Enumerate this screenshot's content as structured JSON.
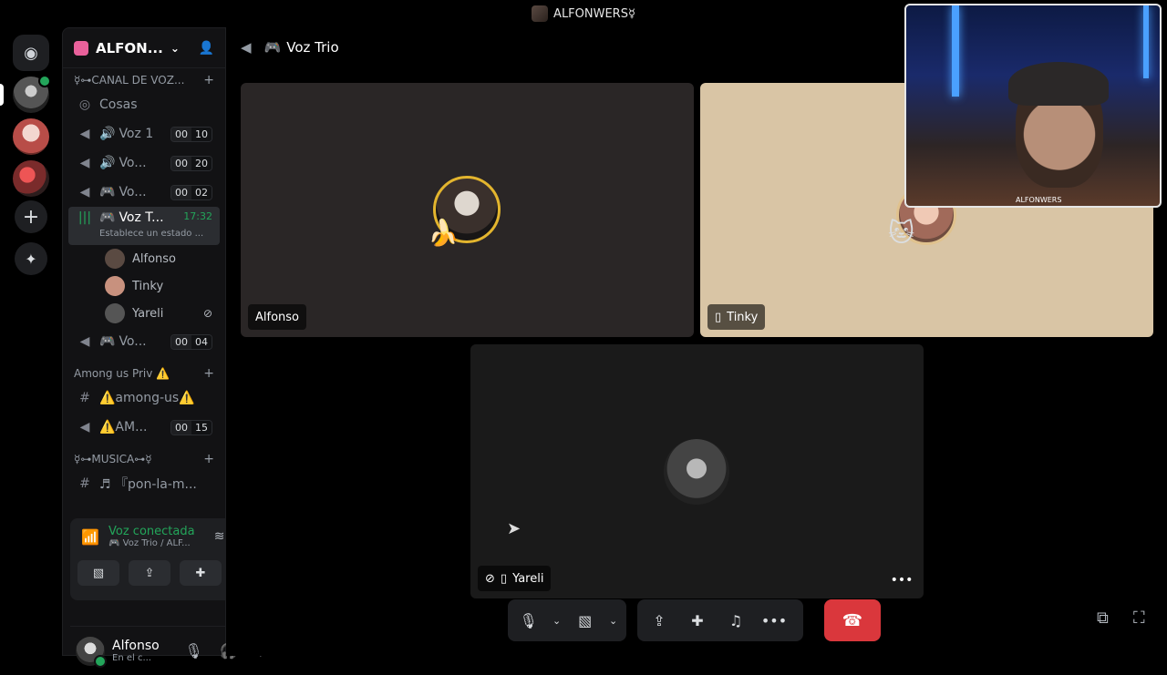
{
  "titlebar": {
    "title": "ALFONWERS☿"
  },
  "servers": {
    "add_icon": "+",
    "discover_icon": "✦"
  },
  "sidebar": {
    "server_name": "ALFON...",
    "categories": [
      {
        "label": "☿⊶CANAL DE VOZ..."
      },
      {
        "label": "Among us Priv ⚠️"
      },
      {
        "label": "☿⊶MUSICA⊶☿"
      }
    ],
    "channels": [
      {
        "label": "Cosas",
        "icon": "stage-icon"
      },
      {
        "label": "Voz 1",
        "emoji": "🔊",
        "count_a": "00",
        "count_b": "10"
      },
      {
        "label": "Vo...",
        "emoji": "🔊",
        "count_a": "00",
        "count_b": "20"
      },
      {
        "label": "Vo...",
        "emoji": "🎮",
        "count_a": "00",
        "count_b": "02"
      },
      {
        "label": "Voz T...",
        "emoji": "🎮",
        "time": "17:32",
        "sub": "Establece un estado ..."
      },
      {
        "label": "Vo...",
        "emoji": "🎮",
        "count_a": "00",
        "count_b": "04"
      },
      {
        "label": "⚠️among-us⚠️"
      },
      {
        "label": "⚠️AM...",
        "count_a": "00",
        "count_b": "15"
      },
      {
        "label": "♬ 『pon-la-m..."
      }
    ],
    "voice_users": [
      {
        "name": "Alfonso",
        "color": "#5a4a42"
      },
      {
        "name": "Tinky",
        "color": "#c8917e"
      },
      {
        "name": "Yareli",
        "color": "#555555"
      }
    ]
  },
  "voicepanel": {
    "status": "Voz conectada",
    "channel": "🎮 Voz Trio / ALF..."
  },
  "userbar": {
    "name": "Alfonso",
    "status": "En el c..."
  },
  "main": {
    "channel_title": "Voz Trio",
    "channel_emoji": "🎮",
    "tiles": [
      {
        "name": "Alfonso"
      },
      {
        "name": "Tinky"
      },
      {
        "name": "Yareli"
      }
    ],
    "camera_tag": "ALFONWERS"
  },
  "colors": {
    "accent_green": "#23a55a",
    "hangup_red": "#da373c",
    "sidebar_bg": "#121214"
  }
}
